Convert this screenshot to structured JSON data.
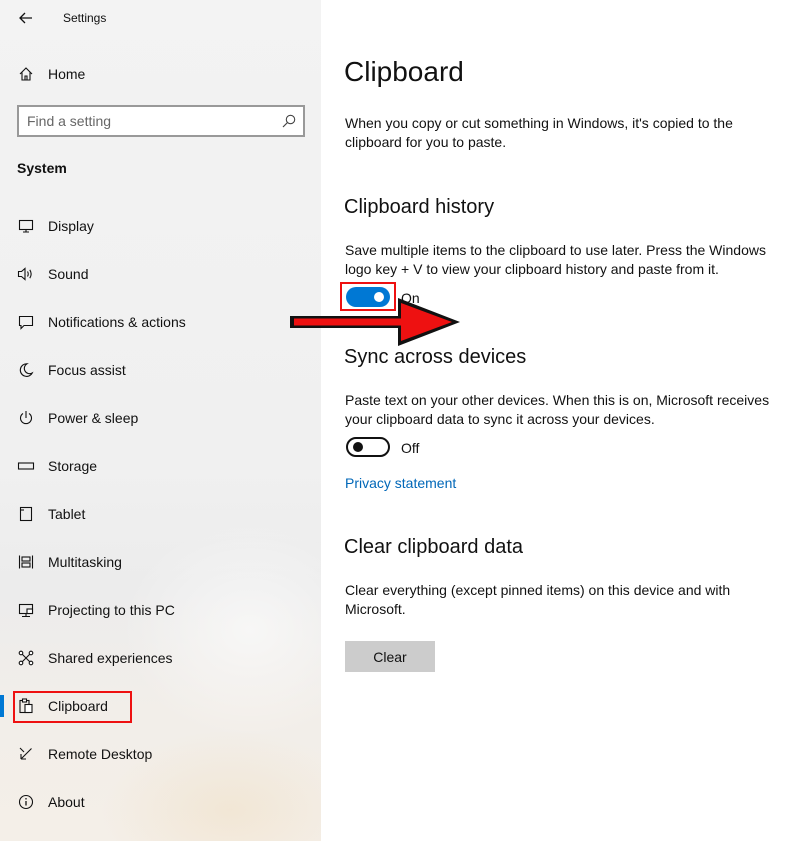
{
  "window": {
    "title": "Settings"
  },
  "sidebar": {
    "home_label": "Home",
    "search": {
      "placeholder": "Find a setting",
      "value": ""
    },
    "section_title": "System",
    "items": [
      {
        "label": "Display",
        "icon": "monitor-icon"
      },
      {
        "label": "Sound",
        "icon": "speaker-icon"
      },
      {
        "label": "Notifications & actions",
        "icon": "notification-icon"
      },
      {
        "label": "Focus assist",
        "icon": "moon-icon"
      },
      {
        "label": "Power & sleep",
        "icon": "power-icon"
      },
      {
        "label": "Storage",
        "icon": "storage-icon"
      },
      {
        "label": "Tablet",
        "icon": "tablet-icon"
      },
      {
        "label": "Multitasking",
        "icon": "multitasking-icon"
      },
      {
        "label": "Projecting to this PC",
        "icon": "projecting-icon"
      },
      {
        "label": "Shared experiences",
        "icon": "shared-experiences-icon"
      },
      {
        "label": "Clipboard",
        "icon": "clipboard-icon",
        "selected": true
      },
      {
        "label": "Remote Desktop",
        "icon": "remote-desktop-icon"
      },
      {
        "label": "About",
        "icon": "info-icon"
      }
    ]
  },
  "main": {
    "title": "Clipboard",
    "intro": "When you copy or cut something in Windows, it's copied to the clipboard for you to paste.",
    "history": {
      "heading": "Clipboard history",
      "description": "Save multiple items to the clipboard to use later. Press the Windows logo key + V to view your clipboard history and paste from it.",
      "toggle_state": "On"
    },
    "sync": {
      "heading": "Sync across devices",
      "description": "Paste text on your other devices. When this is on, Microsoft receives your clipboard data to sync it across your devices.",
      "toggle_state": "Off",
      "privacy_link": "Privacy statement"
    },
    "clear": {
      "heading": "Clear clipboard data",
      "description": "Clear everything (except pinned items) on this device and with Microsoft.",
      "button_label": "Clear"
    }
  },
  "colors": {
    "accent": "#0078d4",
    "link": "#0067b8",
    "annotation": "#ee1111",
    "button_bg": "#cccccc"
  }
}
